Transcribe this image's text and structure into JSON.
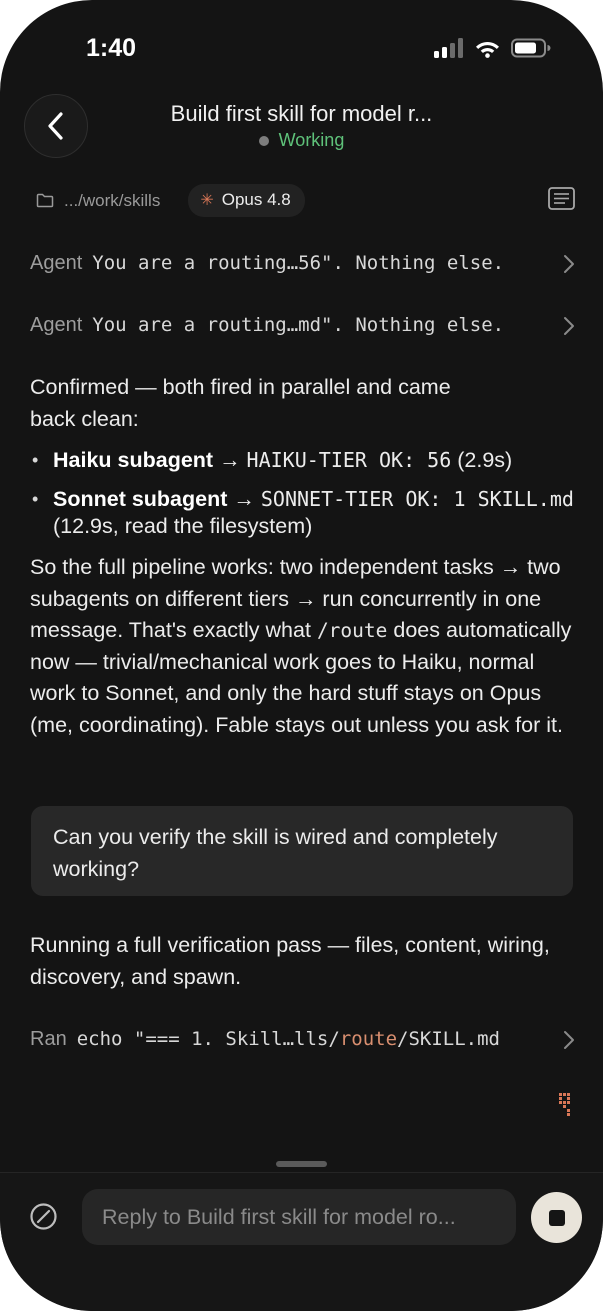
{
  "status_bar": {
    "time": "1:40"
  },
  "header": {
    "title": "Build first skill for model r...",
    "status": "Working"
  },
  "context": {
    "path": ".../work/skills",
    "model": "Opus 4.8"
  },
  "tool_rows": [
    {
      "label": "Agent",
      "text": "You are a routing…56\". Nothing else."
    },
    {
      "label": "Agent",
      "text": "You are a routing…md\". Nothing else."
    }
  ],
  "messages": {
    "confirm": "Confirmed — both fired in parallel and came back clean:",
    "bullets": [
      {
        "name": "Haiku subagent",
        "arrow": " → ",
        "code": "HAIKU-TIER OK: 56",
        "tail": " (2.9s)"
      },
      {
        "name": "Sonnet subagent",
        "arrow": " → ",
        "code": "SONNET-TIER OK: 1 SKILL.md",
        "tail": " (12.9s, read the filesystem)"
      }
    ],
    "summary_before": "So the full pipeline works: two independent tasks → two subagents on different tiers → run concurrently in one message. That's exactly what ",
    "summary_code": "/route",
    "summary_after": " does automatically now — trivial/mechanical work goes to Haiku, normal work to Sonnet, and only the hard stuff stays on Opus (me, coordinating). Fable stays out unless you ask for it.",
    "user": "Can you verify the skill is wired and completely working?",
    "assistant_2": "Running a full verification pass — files, content, wiring, discovery, and spawn."
  },
  "ran_row": {
    "label": "Ran",
    "text_before": "echo \"=== 1. Skill…lls/",
    "text_highlight": "route",
    "text_after": "/SKILL.md"
  },
  "composer": {
    "placeholder": "Reply to Build first skill for model ro..."
  },
  "colors": {
    "accent": "#d97757",
    "status_green": "#5fc27a",
    "background": "#141414"
  }
}
